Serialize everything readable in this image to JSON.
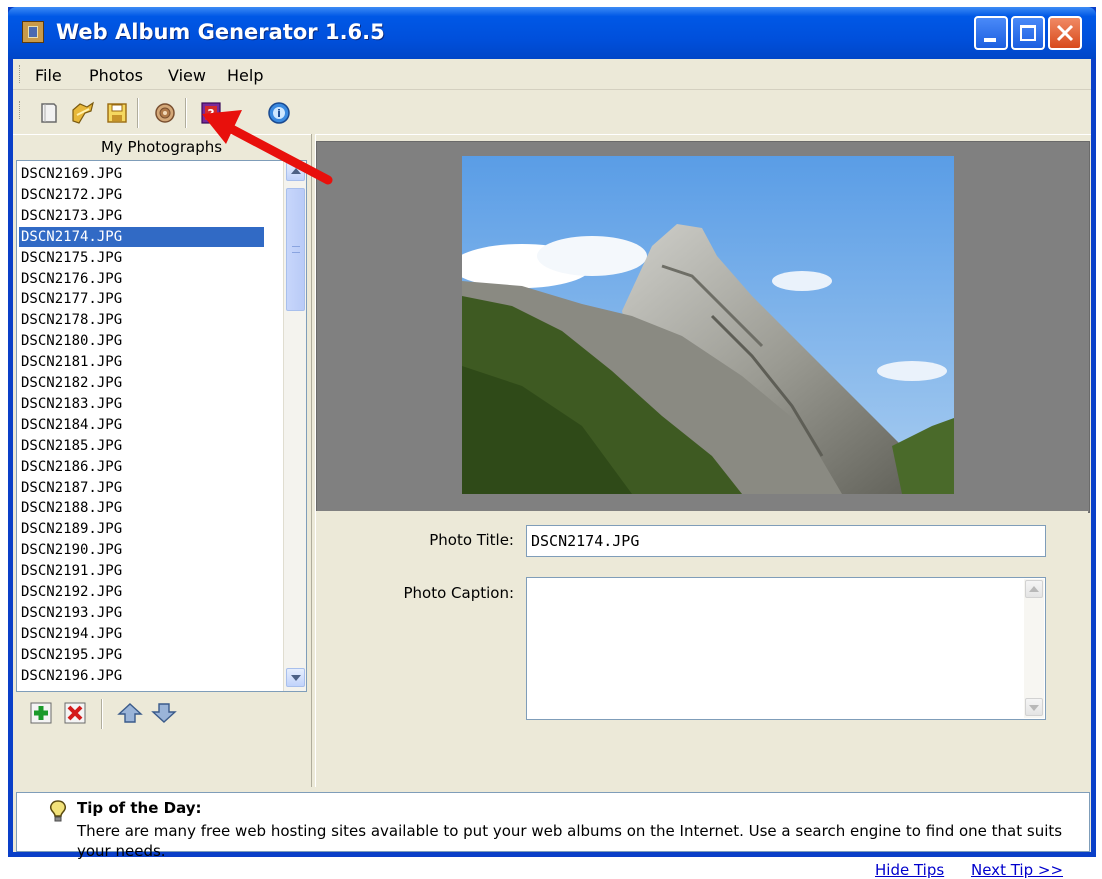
{
  "window": {
    "title": "Web Album Generator 1.6.5"
  },
  "menu": [
    "File",
    "Photos",
    "View",
    "Help"
  ],
  "toolbar": {
    "icons": [
      "new-album-icon",
      "open-album-icon",
      "save-album-icon",
      "generate-album-icon",
      "help-icon",
      "about-icon"
    ]
  },
  "sidebar": {
    "title": "My Photographs",
    "selected_index": 3,
    "items": [
      "DSCN2169.JPG",
      "DSCN2172.JPG",
      "DSCN2173.JPG",
      "DSCN2174.JPG",
      "DSCN2175.JPG",
      "DSCN2176.JPG",
      "DSCN2177.JPG",
      "DSCN2178.JPG",
      "DSCN2180.JPG",
      "DSCN2181.JPG",
      "DSCN2182.JPG",
      "DSCN2183.JPG",
      "DSCN2184.JPG",
      "DSCN2185.JPG",
      "DSCN2186.JPG",
      "DSCN2187.JPG",
      "DSCN2188.JPG",
      "DSCN2189.JPG",
      "DSCN2190.JPG",
      "DSCN2191.JPG",
      "DSCN2192.JPG",
      "DSCN2193.JPG",
      "DSCN2194.JPG",
      "DSCN2195.JPG",
      "DSCN2196.JPG"
    ],
    "list_icons": [
      "add-photo-icon",
      "remove-photo-icon",
      "move-up-icon",
      "move-down-icon"
    ]
  },
  "details": {
    "title_label": "Photo Title:",
    "title_value": "DSCN2174.JPG",
    "caption_label": "Photo Caption:",
    "caption_value": ""
  },
  "tips": {
    "heading": "Tip of the Day:",
    "text": "There are many free web hosting sites available to put your web albums on the Internet. Use a search engine to find one that suits your needs.",
    "hide_label": "Hide Tips",
    "next_label": "Next Tip >>"
  },
  "colors": {
    "titlebar": "#0054e3",
    "selection": "#316ac5",
    "annotation_arrow": "#e8100c",
    "link": "#0000cc"
  }
}
